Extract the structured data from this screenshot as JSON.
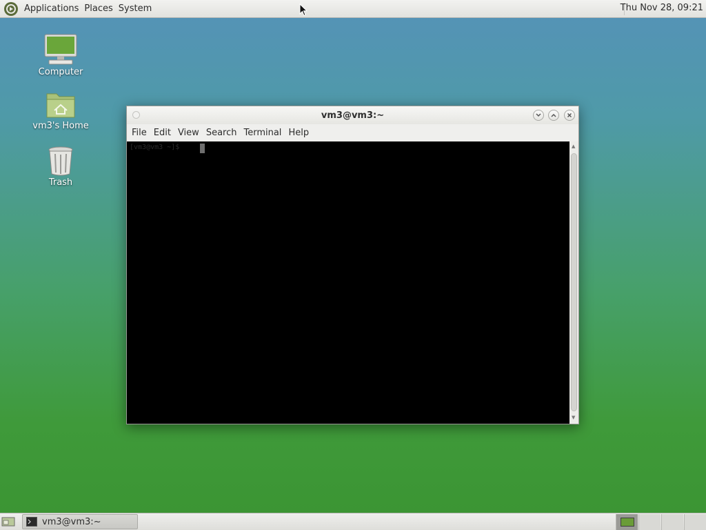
{
  "top_panel": {
    "menus": [
      "Applications",
      "Places",
      "System"
    ],
    "clock": "Thu Nov 28, 09:21"
  },
  "desktop": {
    "icons": [
      {
        "label": "Computer",
        "icon": "computer-icon"
      },
      {
        "label": "vm3's Home",
        "icon": "home-folder-icon"
      },
      {
        "label": "Trash",
        "icon": "trash-icon"
      }
    ]
  },
  "terminal_window": {
    "title": "vm3@vm3:~",
    "menus": [
      "File",
      "Edit",
      "View",
      "Search",
      "Terminal",
      "Help"
    ],
    "prompt": "[vm3@vm3 ~]$",
    "colors": {
      "background": "#000000",
      "prompt_text": "#2b2b2b"
    }
  },
  "bottom_panel": {
    "task_label": "vm3@vm3:~",
    "workspaces": 4,
    "active_workspace": 1
  },
  "colors": {
    "desktop_top": "#5592b8",
    "desktop_bottom": "#3b9432",
    "panel": "#e8e8e4"
  }
}
